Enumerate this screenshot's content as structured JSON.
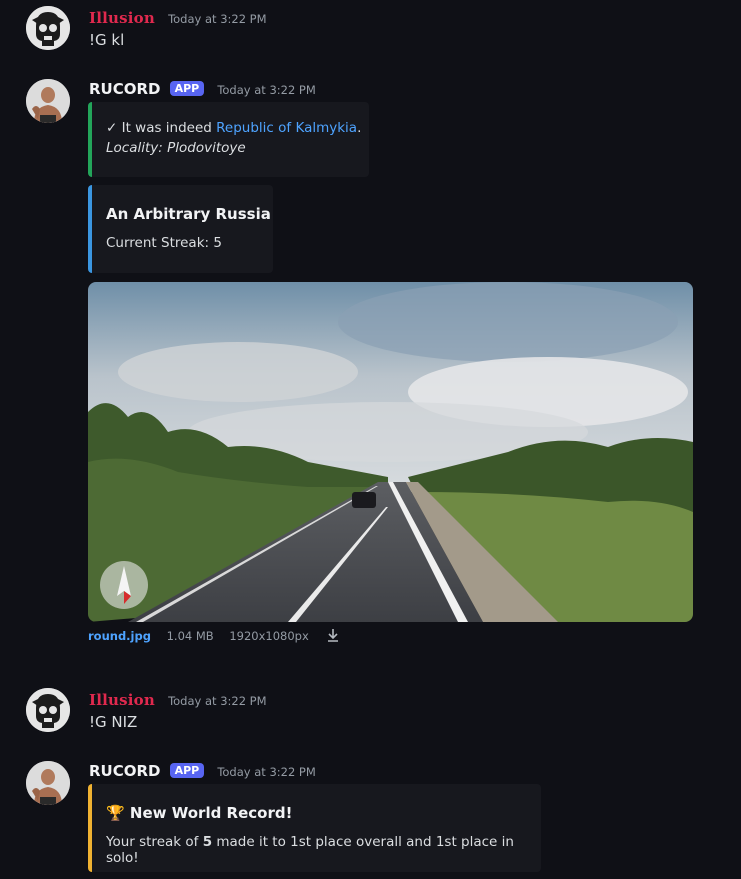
{
  "messages": [
    {
      "username": "Illusion",
      "timestamp": "Today at 3:22 PM",
      "text": "!G kl"
    },
    {
      "username": "RUCORD",
      "badge": "APP",
      "timestamp": "Today at 3:22 PM",
      "embed1": {
        "check": "✓ It was indeed ",
        "place": "Republic of Kalmykia",
        "period": ".",
        "locality": "Locality: Plodovitoye",
        "color": "#23a55a"
      },
      "embed2": {
        "title": "An Arbitrary Russia",
        "streak": "Current Streak: 5",
        "color": "#3b96e0"
      },
      "attachment": {
        "filename": "round.jpg",
        "size": "1.04 MB",
        "resolution": "1920x1080px",
        "icon": "download-icon"
      }
    },
    {
      "username": "Illusion",
      "timestamp": "Today at 3:22 PM",
      "text": "!G NIZ"
    },
    {
      "username": "RUCORD",
      "badge": "APP",
      "timestamp": "Today at 3:22 PM",
      "embed": {
        "trophy": "🏆",
        "title": "New World Record!",
        "desc_before": "Your streak of ",
        "desc_bold": "5",
        "desc_after": " made it to 1st place overall and 1st place in solo!",
        "color": "#f0b232"
      }
    }
  ],
  "colors": {
    "background": "#0f1016",
    "embed_bg": "#17181e",
    "link": "#4ea3ff",
    "bot_badge": "#5865f2",
    "username_illusion": "#e0294e"
  }
}
